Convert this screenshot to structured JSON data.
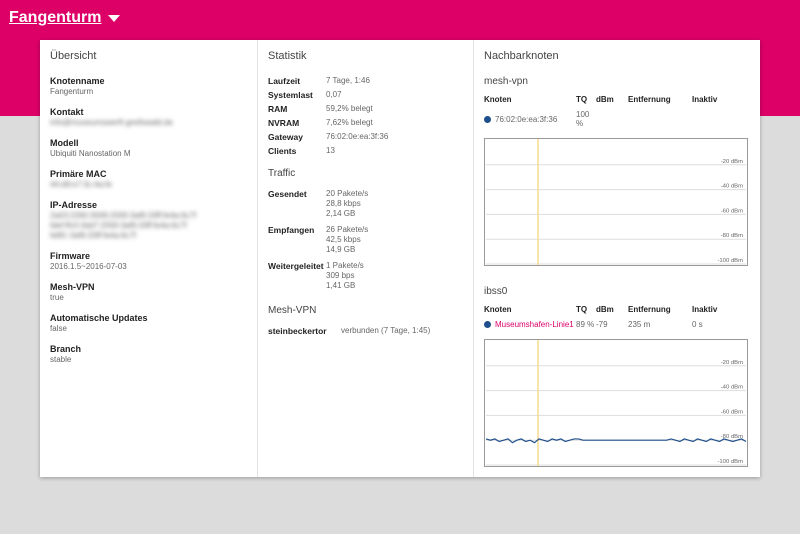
{
  "header": {
    "title": "Fangenturm"
  },
  "overview": {
    "heading": "Übersicht",
    "fields": [
      {
        "key": "Knotenname",
        "value": "Fangenturm",
        "blurred": false
      },
      {
        "key": "Kontakt",
        "value": "info@museumswerft-greifswald.de",
        "blurred": true
      },
      {
        "key": "Modell",
        "value": "Ubiquiti Nanostation M",
        "blurred": false
      },
      {
        "key": "Primäre MAC",
        "value": "44:d9:e7:3c:4a:fe",
        "blurred": true
      },
      {
        "key": "IP-Adresse",
        "value": "2a03:2260:3006:2000:3af6:33ff:fe4a:6c7f\nfdef:ffc0:3dd7:2000:3af6:33ff:fe4a:6c7f\nfe80::3af6:33ff:fe4a:6c7f",
        "blurred": true
      },
      {
        "key": "Firmware",
        "value": "2016.1.5~2016-07-03",
        "blurred": false
      },
      {
        "key": "Mesh-VPN",
        "value": "true",
        "blurred": false
      },
      {
        "key": "Automatische Updates",
        "value": "false",
        "blurred": false
      },
      {
        "key": "Branch",
        "value": "stable",
        "blurred": false
      }
    ]
  },
  "stats": {
    "heading": "Statistik",
    "rows": [
      {
        "key": "Laufzeit",
        "value": "7 Tage, 1:46"
      },
      {
        "key": "Systemlast",
        "value": "0,07"
      },
      {
        "key": "RAM",
        "value": "59,2% belegt"
      },
      {
        "key": "NVRAM",
        "value": "7,62% belegt"
      },
      {
        "key": "Gateway",
        "value": "76:02:0e:ea:3f:36"
      },
      {
        "key": "Clients",
        "value": "13"
      }
    ],
    "traffic_heading": "Traffic",
    "traffic": [
      {
        "key": "Gesendet",
        "value": "20 Pakete/s\n28,8 kbps\n2,14 GB"
      },
      {
        "key": "Empfangen",
        "value": "26 Pakete/s\n42,5 kbps\n14,9 GB"
      },
      {
        "key": "Weitergeleitet",
        "value": "1 Pakete/s\n309 bps\n1,41 GB"
      }
    ],
    "meshvpn_heading": "Mesh-VPN",
    "meshvpn": {
      "key": "steinbeckertor",
      "value": "verbunden (7 Tage, 1:45)"
    }
  },
  "neighbours": {
    "heading": "Nachbarknoten",
    "columns": [
      "Knoten",
      "TQ",
      "dBm",
      "Entfernung",
      "Inaktiv"
    ],
    "groups": [
      {
        "title": "mesh-vpn",
        "row": {
          "node": "76:02:0e:ea:3f:36",
          "tq": "100 %",
          "dbm": "",
          "distance": "",
          "inactive": "",
          "dot_color": "#1f4e8c"
        },
        "chart": {
          "y_ticks": [
            "-20 dBm",
            "-40 dBm",
            "-60 dBm",
            "-80 dBm",
            "-100 dBm"
          ],
          "y_tick_values": [
            -20,
            -40,
            -60,
            -80,
            -100
          ],
          "ylim": [
            -100,
            0
          ],
          "marker_x": 0.2,
          "series": []
        }
      },
      {
        "title": "ibss0",
        "row": {
          "node": "Museumshafen-Linie1",
          "tq": "89 %",
          "dbm": "-79",
          "distance": "235 m",
          "inactive": "0 s",
          "dot_color": "#1f4e8c"
        },
        "chart": {
          "y_ticks": [
            "-20 dBm",
            "-40 dBm",
            "-60 dBm",
            "-80 dBm",
            "-100 dBm"
          ],
          "y_tick_values": [
            -20,
            -40,
            -60,
            -80,
            -100
          ],
          "ylim": [
            -100,
            0
          ],
          "marker_x": 0.2,
          "series": [
            -79,
            -80,
            -79,
            -81,
            -80,
            -79,
            -82,
            -80,
            -79,
            -81,
            -80,
            -82,
            -79,
            -80,
            -81,
            -79,
            -80,
            -79,
            -81,
            -80,
            -79,
            -79,
            -80,
            -80,
            -80,
            -80,
            -80,
            -80,
            -80,
            -80,
            -80,
            -80,
            -80,
            -80,
            -80,
            -80,
            -80,
            -80,
            -80,
            -80,
            -80,
            -80,
            -79,
            -80,
            -81,
            -79,
            -80,
            -81,
            -79,
            -80,
            -81,
            -79,
            -80,
            -81,
            -79,
            -80,
            -81,
            -80,
            -79,
            -81
          ]
        }
      }
    ]
  }
}
